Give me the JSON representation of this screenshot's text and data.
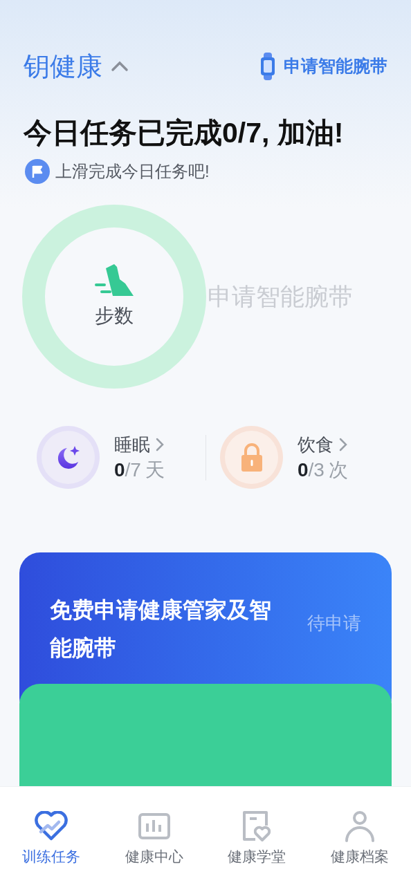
{
  "header": {
    "app_title": "钥健康",
    "expanded": true,
    "band_link": "申请智能腕带"
  },
  "headline": "今日任务已完成0/7, 加油!",
  "hint": "上滑完成今日任务吧!",
  "steps_ring": {
    "label": "步数",
    "side_text": "申请智能腕带"
  },
  "stats": [
    {
      "kind": "sleep",
      "label": "睡眠",
      "done": "0",
      "total": "/7",
      "unit": "天"
    },
    {
      "kind": "diet",
      "label": "饮食",
      "done": "0",
      "total": "/3",
      "unit": "次"
    }
  ],
  "cards": [
    {
      "kind": "apply",
      "title": "免费申请健康管家及智能腕带",
      "status": "待申请"
    },
    {
      "kind": "steps"
    }
  ],
  "nav": [
    {
      "kind": "training",
      "label": "训练任务",
      "selected": true
    },
    {
      "kind": "center",
      "label": "健康中心",
      "selected": false
    },
    {
      "kind": "school",
      "label": "健康学堂",
      "selected": false
    },
    {
      "kind": "profile",
      "label": "健康档案",
      "selected": false
    }
  ]
}
